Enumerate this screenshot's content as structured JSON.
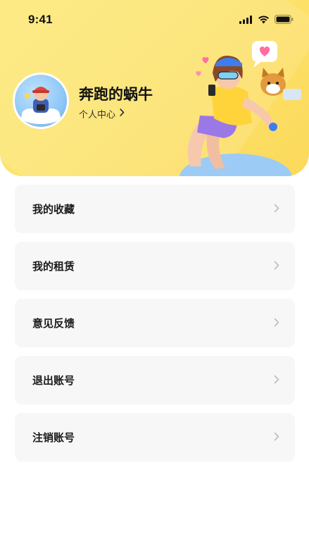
{
  "status_bar": {
    "time": "9:41"
  },
  "profile": {
    "username": "奔跑的蜗牛",
    "center_link": "个人中心"
  },
  "menu": {
    "items": [
      {
        "label": "我的收藏"
      },
      {
        "label": "我的租赁"
      },
      {
        "label": "意见反馈"
      },
      {
        "label": "退出账号"
      },
      {
        "label": "注销账号"
      }
    ]
  },
  "colors": {
    "header_yellow": "#fce26c",
    "card_bg": "#f7f7f8",
    "text_primary": "#1a1a1a",
    "chevron_gray": "#bdbdbd"
  },
  "icons": [
    "signal-icon",
    "wifi-icon",
    "battery-icon",
    "chevron-right-icon"
  ]
}
